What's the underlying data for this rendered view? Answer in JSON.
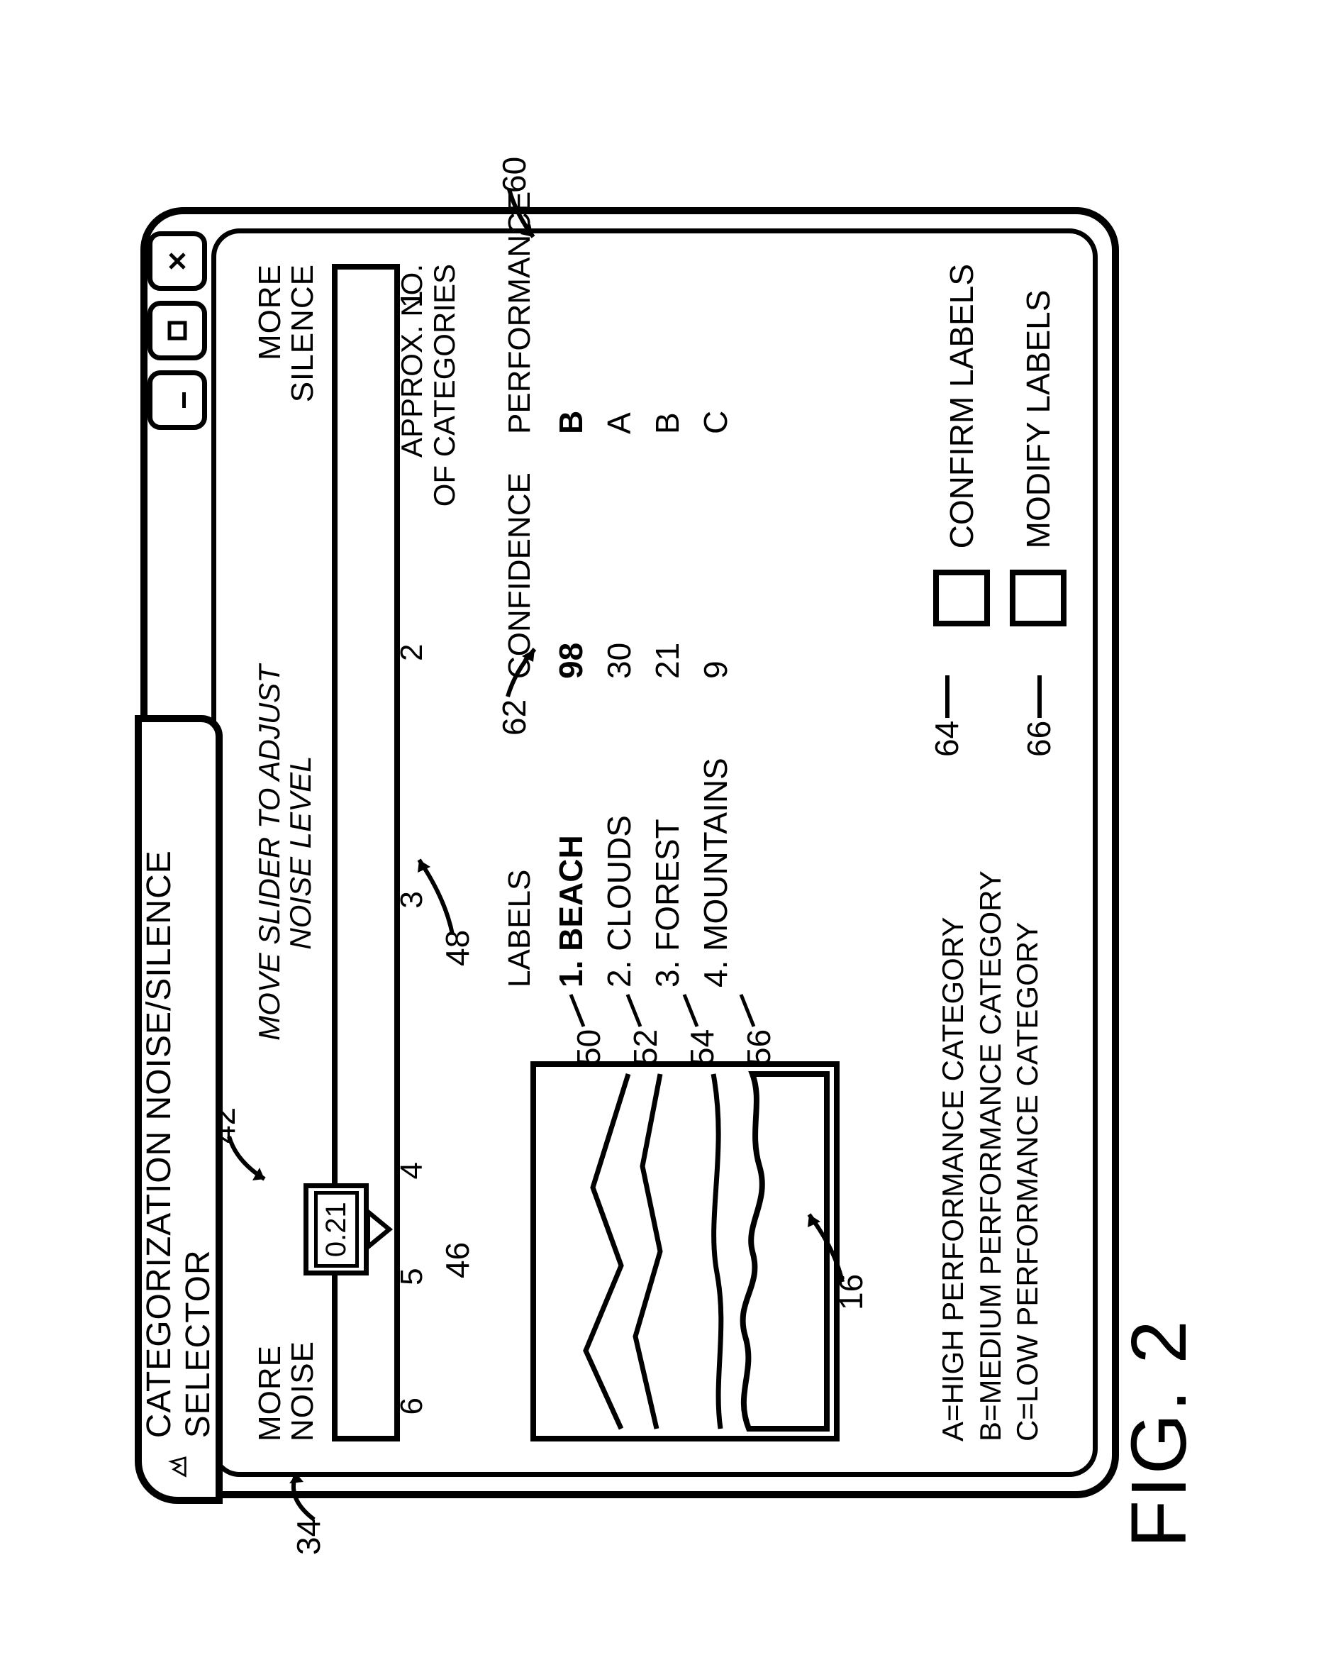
{
  "window": {
    "title": "CATEGORIZATION NOISE/SILENCE SELECTOR"
  },
  "slider": {
    "left_end_1": "MORE",
    "left_end_2": "NOISE",
    "instruction_1": "MOVE SLIDER TO ADJUST",
    "instruction_2": "NOISE LEVEL",
    "right_end_1": "MORE",
    "right_end_2": "SILENCE",
    "value": "0.21",
    "ticks": [
      "6",
      "5",
      "4",
      "3",
      "2",
      "1"
    ],
    "tick_positions_pct": [
      3,
      14,
      23,
      46,
      67,
      97
    ],
    "thumb_pos_pct": 18,
    "approx_line1": "APPROX. NO.",
    "approx_line2": "OF CATEGORIES"
  },
  "labels_header": "LABELS",
  "confidence_header": "CONFIDENCE",
  "performance_header": "PERFORMANCE",
  "rows": [
    {
      "idx": "1.",
      "name": "BEACH",
      "conf": "98",
      "perf": "B",
      "bold": true
    },
    {
      "idx": "2.",
      "name": "CLOUDS",
      "conf": "30",
      "perf": "A",
      "bold": false
    },
    {
      "idx": "3.",
      "name": "FOREST",
      "conf": "21",
      "perf": "B",
      "bold": false
    },
    {
      "idx": "4.",
      "name": "MOUNTAINS",
      "conf": "9",
      "perf": "C",
      "bold": false
    }
  ],
  "legend": {
    "a": "A=HIGH PERFORMANCE CATEGORY",
    "b": "B=MEDIUM PERFORMANCE CATEGORY",
    "c": "C=LOW PERFORMANCE CATEGORY"
  },
  "actions": {
    "confirm": "CONFIRM LABELS",
    "modify": "MODIFY LABELS"
  },
  "figure": "FIG. 2",
  "refs": {
    "r34": "34",
    "r42": "42",
    "r46": "46",
    "r48": "48",
    "r50": "50",
    "r52": "52",
    "r54": "54",
    "r56": "56",
    "r16": "16",
    "r62": "62",
    "r60": "60",
    "r64": "64",
    "r66": "66"
  }
}
